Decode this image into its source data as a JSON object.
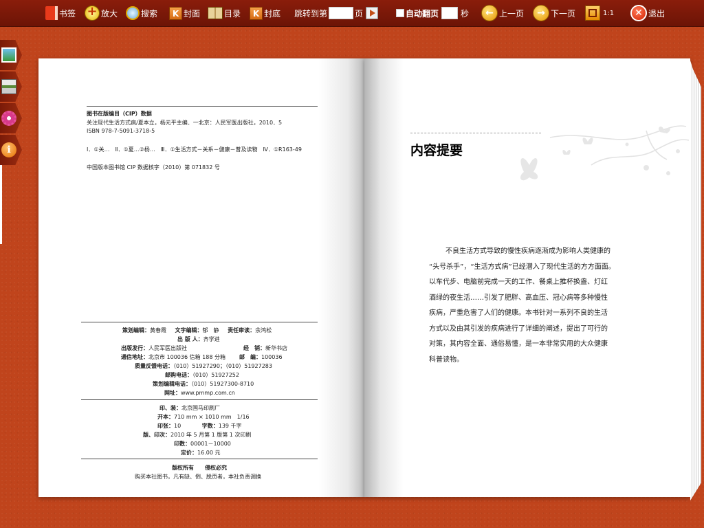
{
  "toolbar": {
    "bookmark": "书签",
    "zoom": "放大",
    "search": "搜索",
    "cover": "封面",
    "toc": "目录",
    "back_cover": "封底",
    "jump_prefix": "跳转到第",
    "jump_suffix": "页",
    "auto_flip": "自动翻页",
    "seconds": "秒",
    "prev": "上一页",
    "next": "下一页",
    "ratio": "1:1",
    "exit": "退出",
    "icons": [
      "bookmark-icon",
      "zoom-in-icon",
      "search-icon",
      "first-page-icon",
      "toc-icon",
      "last-page-icon",
      "go-icon",
      "prev-arrow-icon",
      "next-arrow-icon",
      "fit-icon",
      "close-icon"
    ]
  },
  "side_tabs": [
    "image-icon",
    "print-icon",
    "settings-icon",
    "info-icon"
  ],
  "left_page": {
    "cip_title": "图书在版编目（CIP）数据",
    "cip_line1": "关注现代生活方式病/夏本立，杨元平主编．一北京：人民军医出版社，2010．5",
    "cip_isbn": "ISBN 978-7-5091-3718-5",
    "cip_class": "Ⅰ．①关…　Ⅱ．①夏…②杨…　Ⅲ．①生活方式－关系－健康－普及读物　Ⅳ．①R163-49",
    "cip_number": "中国版本图书馆 CIP 数据核字（2010）第 071832 号",
    "editors": {
      "planning_label": "策划编辑：",
      "planning": "黄春霞",
      "text_label": "文字编辑：",
      "text": "郁　静",
      "review_label": "责任审读：",
      "review": "余鸿松",
      "publisher_label": "出 版 人：",
      "publisher": "齐学进"
    },
    "publish": {
      "issuer_label": "出版发行：",
      "issuer": "人民军医出版社",
      "seller_label": "经　销：",
      "seller": "新华书店",
      "address_label": "通信地址：",
      "address": "北京市 100036 信箱 188 分箱",
      "postcode_label": "邮　编：",
      "postcode": "100036",
      "feedback_label": "质量反馈电话：",
      "feedback": "（010）51927290；（010）51927283",
      "mail_label": "邮购电话：",
      "mail": "（010）51927252",
      "editorial_label": "策划编辑电话：",
      "editorial": "（010）51927300-8710",
      "web_label": "网址：",
      "web": "www.pmmp.com.cn"
    },
    "print": {
      "printer_label": "印、装：",
      "printer": "北京国马印刷厂",
      "format_label": "开本：",
      "format": "710 mm × 1010 mm　1/16",
      "sheets_label": "印张：",
      "sheets": "10",
      "words_label": "字数：",
      "words": "139 千字",
      "edition_label": "版、印次：",
      "edition": "2010 年 5 月第 1 版第 1 次印刷",
      "count_label": "印数：",
      "count": "00001－10000",
      "price_label": "定价：",
      "price": "16.00 元"
    },
    "copyright": "版权所有　　侵权必究",
    "copyright_note": "购买本社图书，凡有缺、倒、脱页者，本社负责调换"
  },
  "right_page": {
    "title": "内容提要",
    "lines": [
      "不良生活方式导致的慢性疾病逐渐成为影响人类健康的",
      "“头号杀手”，“生活方式病”已经潜入了现代生活的方方面面。",
      "以车代步、电脑前完成一天的工作、餐桌上推杯换盏、灯红",
      "酒绿的夜生活……引发了肥胖、高血压、冠心病等多种慢性",
      "疾病，严重危害了人们的健康。本书针对一系列不良的生活",
      "方式以及由其引发的疾病进行了详细的阐述，提出了可行的",
      "对策，其内容全面、通俗易懂，是一本非常实用的大众健康",
      "科普读物。"
    ]
  }
}
